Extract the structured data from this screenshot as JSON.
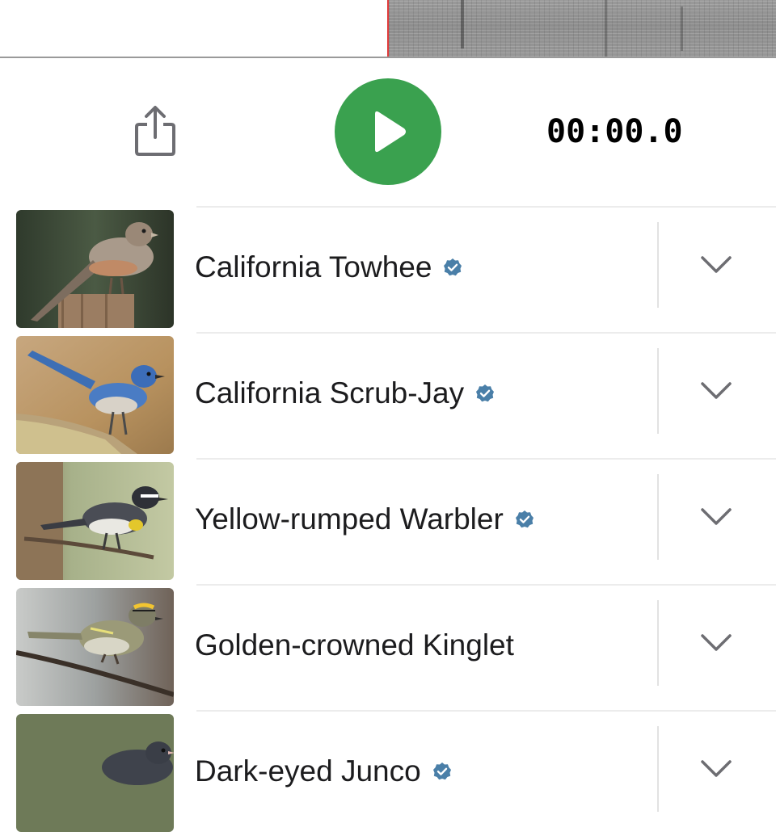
{
  "player": {
    "time": "00:00.0",
    "share_icon": "share-icon",
    "play_icon": "play-icon",
    "accent": "#3aa14f",
    "playhead_color": "#e03b3b"
  },
  "results": [
    {
      "name": "California Towhee",
      "verified": true,
      "photo": "california-towhee-photo"
    },
    {
      "name": "California Scrub-Jay",
      "verified": true,
      "photo": "california-scrub-jay-photo"
    },
    {
      "name": "Yellow-rumped Warbler",
      "verified": true,
      "photo": "yellow-rumped-warbler-photo"
    },
    {
      "name": "Golden-crowned Kinglet",
      "verified": false,
      "photo": "golden-crowned-kinglet-photo"
    },
    {
      "name": "Dark-eyed Junco",
      "verified": true,
      "photo": "dark-eyed-junco-photo"
    }
  ],
  "icons": {
    "verified": "verified-badge-icon",
    "expand": "chevron-down-icon"
  },
  "colors": {
    "verified_badge": "#4a7fa8",
    "chevron": "#6d6d72"
  }
}
